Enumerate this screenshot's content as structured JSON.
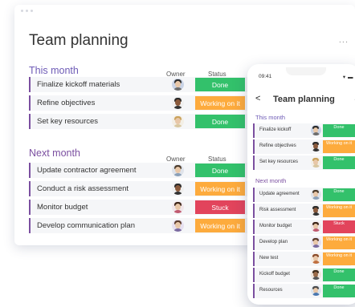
{
  "window": {
    "title": "Team planning",
    "more": "...",
    "columns": {
      "owner": "Owner",
      "status": "Status"
    },
    "groups": [
      {
        "title": "This month",
        "color": "#6e5bb6",
        "rows": [
          {
            "label": "Finalize kickoff materials",
            "status": "Done",
            "status_color": "#33c16b"
          },
          {
            "label": "Refine objectives",
            "status": "Working on it",
            "status_color": "#fdab3d"
          },
          {
            "label": "Set key resources",
            "status": "Done",
            "status_color": "#33c16b"
          }
        ]
      },
      {
        "title": "Next month",
        "color": "#7b4fa0",
        "rows": [
          {
            "label": "Update contractor agreement",
            "status": "Done",
            "status_color": "#33c16b"
          },
          {
            "label": "Conduct a risk assessment",
            "status": "Working on it",
            "status_color": "#fdab3d"
          },
          {
            "label": "Monitor budget",
            "status": "Stuck",
            "status_color": "#e2445c"
          },
          {
            "label": "Develop communication plan",
            "status": "Working on it",
            "status_color": "#fdab3d"
          }
        ]
      }
    ]
  },
  "phone": {
    "time": "09:41",
    "title": "Team planning",
    "back": "<",
    "more": "...",
    "signal": "▾ ▬",
    "groups": [
      {
        "title": "This month",
        "color": "#6e5bb6",
        "rows": [
          {
            "label": "Finalize kickoff",
            "status": "Done",
            "status_color": "#33c16b"
          },
          {
            "label": "Refine objectives",
            "status": "Working on it",
            "status_color": "#fdab3d"
          },
          {
            "label": "Set key resources",
            "status": "Done",
            "status_color": "#33c16b"
          }
        ]
      },
      {
        "title": "Next month",
        "color": "#7b4fa0",
        "rows": [
          {
            "label": "Update agreement",
            "status": "Done",
            "status_color": "#33c16b"
          },
          {
            "label": "Risk assessment",
            "status": "Working on it",
            "status_color": "#fdab3d"
          },
          {
            "label": "Monitor budget",
            "status": "Stuck",
            "status_color": "#e2445c"
          },
          {
            "label": "Develop plan",
            "status": "Working on it",
            "status_color": "#fdab3d"
          },
          {
            "label": "New test",
            "status": "Working on it",
            "status_color": "#fdab3d"
          },
          {
            "label": "Kickoff budget",
            "status": "Done",
            "status_color": "#33c16b"
          },
          {
            "label": "Resources",
            "status": "Done",
            "status_color": "#33c16b"
          }
        ]
      }
    ]
  }
}
